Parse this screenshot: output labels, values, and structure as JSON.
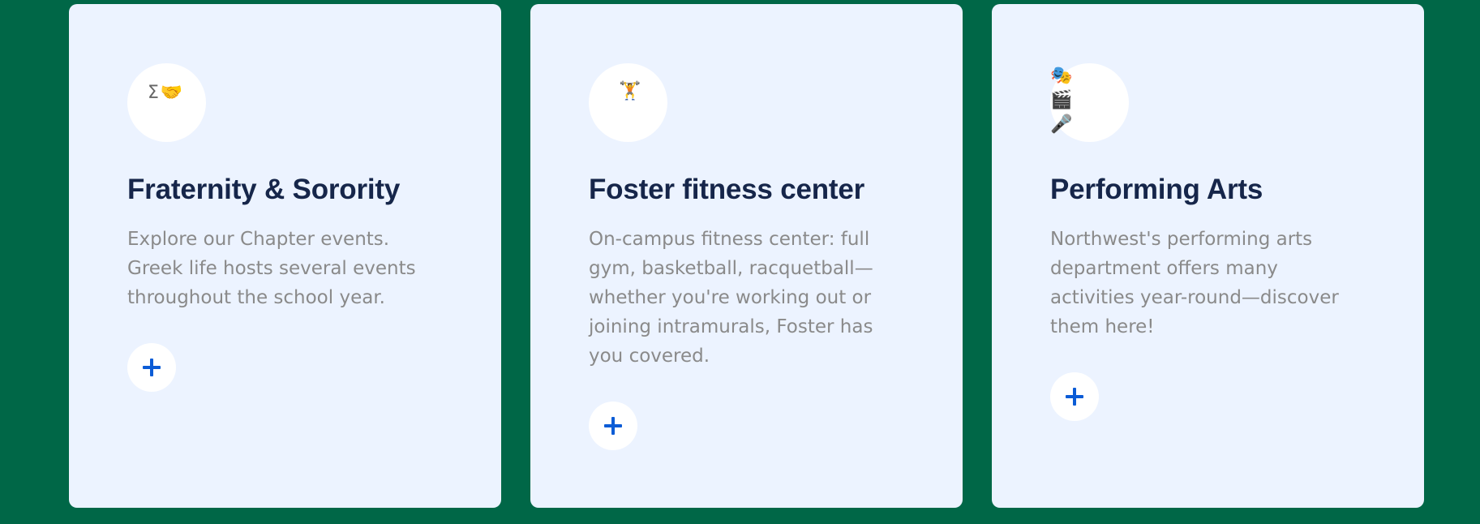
{
  "cards": [
    {
      "title": "Fraternity & Sorority",
      "description": "Explore our Chapter events. Greek life hosts several events throughout the school year.",
      "icons": [
        "Σ",
        "🤝"
      ],
      "button_symbol": "plus-icon"
    },
    {
      "title": "Foster fitness center",
      "description": "On-campus fitness center: full gym, basketball, racquetball—whether you're working out or joining intramurals, Foster has you covered.",
      "icons": [
        "🏋️"
      ],
      "button_symbol": "plus-icon"
    },
    {
      "title": "Performing Arts",
      "description": "Northwest's performing arts department offers many activities year-round—discover them here!",
      "icons": [
        "🎭",
        "🎬",
        "🎤"
      ],
      "button_symbol": "plus-icon"
    }
  ],
  "colors": {
    "background": "#006747",
    "card_background": "#ecf3ff",
    "title": "#16264a",
    "description": "#8a8a8a",
    "accent": "#0b5cd6"
  }
}
